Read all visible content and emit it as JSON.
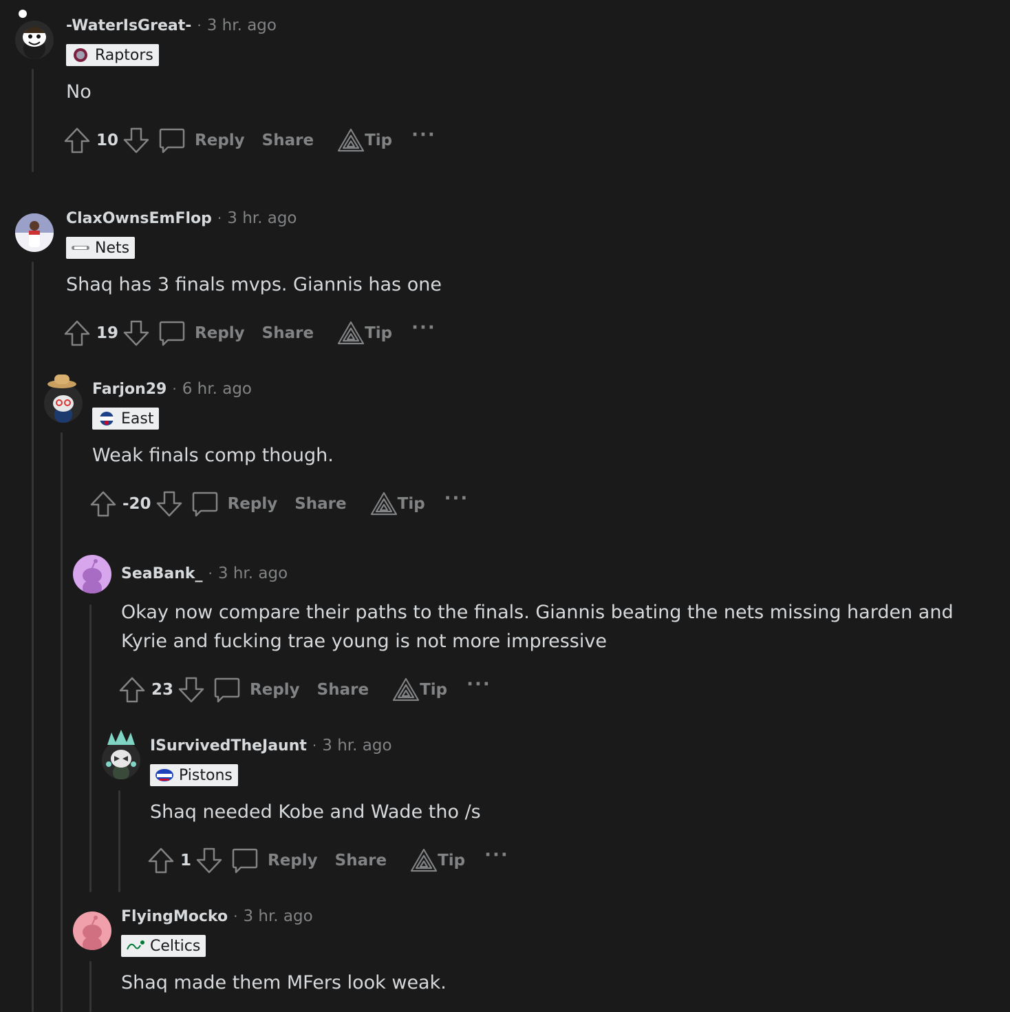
{
  "comments": [
    {
      "username": "-WaterIsGreat-",
      "time": "3 hr. ago",
      "flair": "Raptors",
      "body": [
        "No"
      ],
      "votes": "10"
    },
    {
      "username": "ClaxOwnsEmFlop",
      "time": "3 hr. ago",
      "flair": "Nets",
      "body": [
        "Shaq has 3 finals mvps. Giannis has one"
      ],
      "votes": "19"
    },
    {
      "username": "Farjon29",
      "time": "6 hr. ago",
      "flair": "East",
      "body": [
        "Weak finals comp though."
      ],
      "votes": "-20"
    },
    {
      "username": "SeaBank_",
      "time": "3 hr. ago",
      "flair": "",
      "body": [
        "Okay now compare their paths to the finals. Giannis beating the nets missing harden and",
        "Kyrie and fucking trae young is not more impressive"
      ],
      "votes": "23"
    },
    {
      "username": "ISurvivedTheJaunt",
      "time": "3 hr. ago",
      "flair": "Pistons",
      "body": [
        "Shaq needed Kobe and Wade tho /s"
      ],
      "votes": "1"
    },
    {
      "username": "FlyingMocko",
      "time": "3 hr. ago",
      "flair": "Celtics",
      "body": [
        "Shaq made them MFers look weak."
      ],
      "votes": ""
    }
  ],
  "actions": {
    "reply": "Reply",
    "share": "Share",
    "tip": "Tip",
    "separator": "·",
    "more": "···"
  },
  "colors": {
    "background": "#1a1a1b",
    "text": "#d7dadc",
    "muted": "#818384",
    "flair_bg": "#edeff1",
    "thread_line": "#343536"
  }
}
